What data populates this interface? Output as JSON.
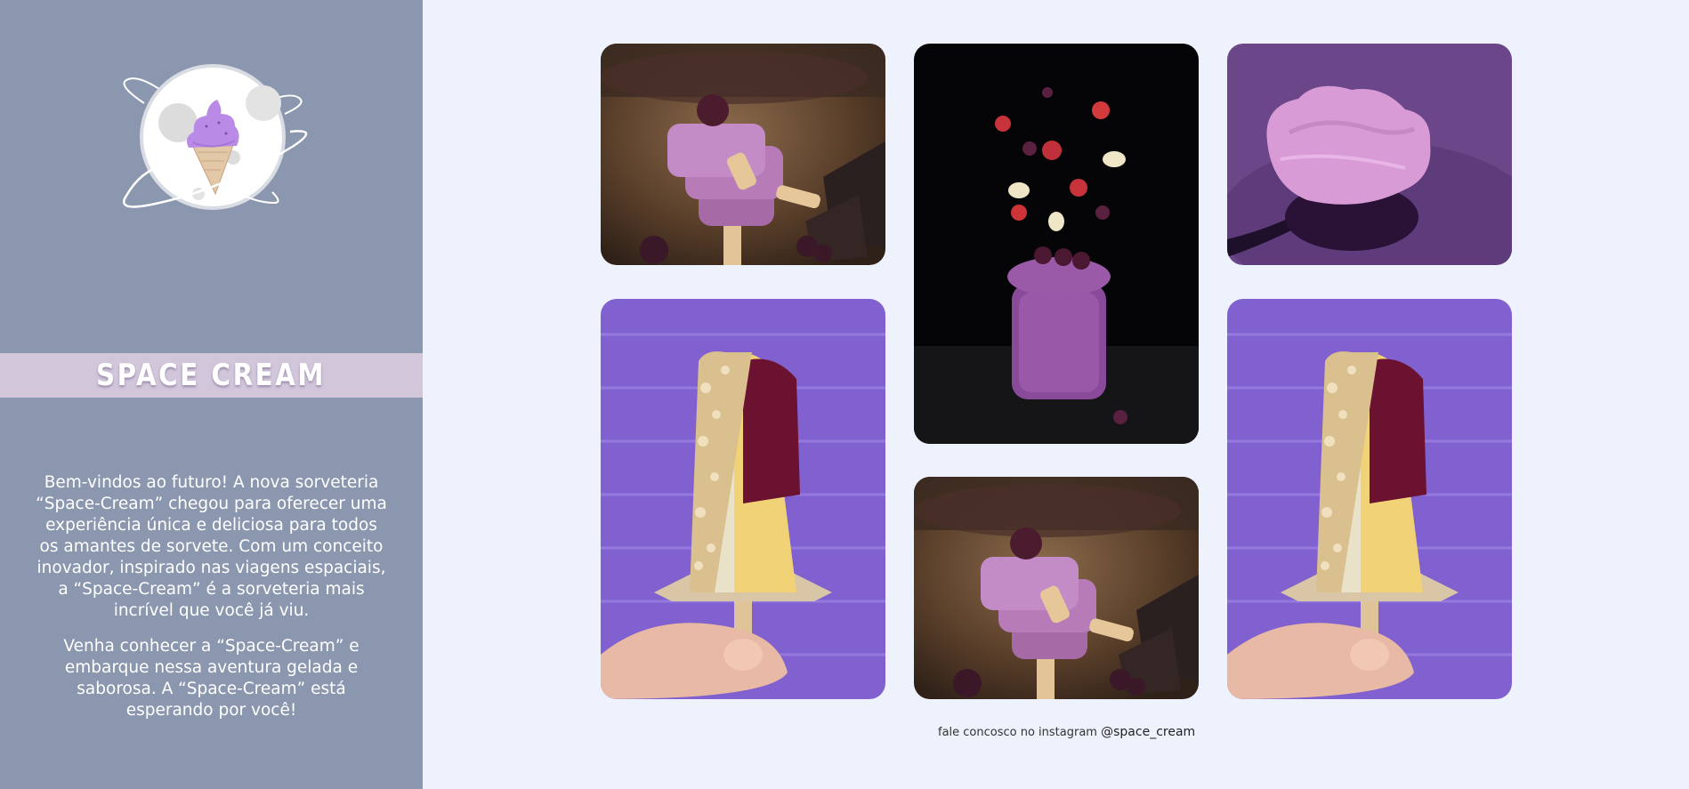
{
  "brand": {
    "name": "SPACE CREAM"
  },
  "intro": {
    "paragraph_1": "Bem-vindos ao futuro! A nova sorveteria “Space-Cream” chegou para oferecer uma experiência única e deliciosa para todos os amantes de sorvete. Com um conceito inovador, inspirado nas viagens espaciais, a “Space-Cream” é a sorveteria mais incrível que você já viu.",
    "paragraph_2": "Venha conhecer a “Space-Cream” e embarque nessa aventura gelada e saborosa. A “Space-Cream” está esperando por você!"
  },
  "gallery": {
    "images": [
      {
        "name": "stacked-berry-popsicles"
      },
      {
        "name": "berry-smoothie-jar"
      },
      {
        "name": "purple-ice-cream-spoon"
      },
      {
        "name": "nut-coated-popsicle"
      },
      {
        "name": "stacked-berry-popsicles"
      },
      {
        "name": "nut-coated-popsicle"
      }
    ]
  },
  "footer": {
    "text": "fale concosco no instagram",
    "instagram_handle": "@space_cream"
  },
  "colors": {
    "sidebar_bg": "#8b97ae",
    "page_bg": "#eef2fd",
    "brand_band": "#d1c6da",
    "accent_purple": "#b482e8"
  }
}
